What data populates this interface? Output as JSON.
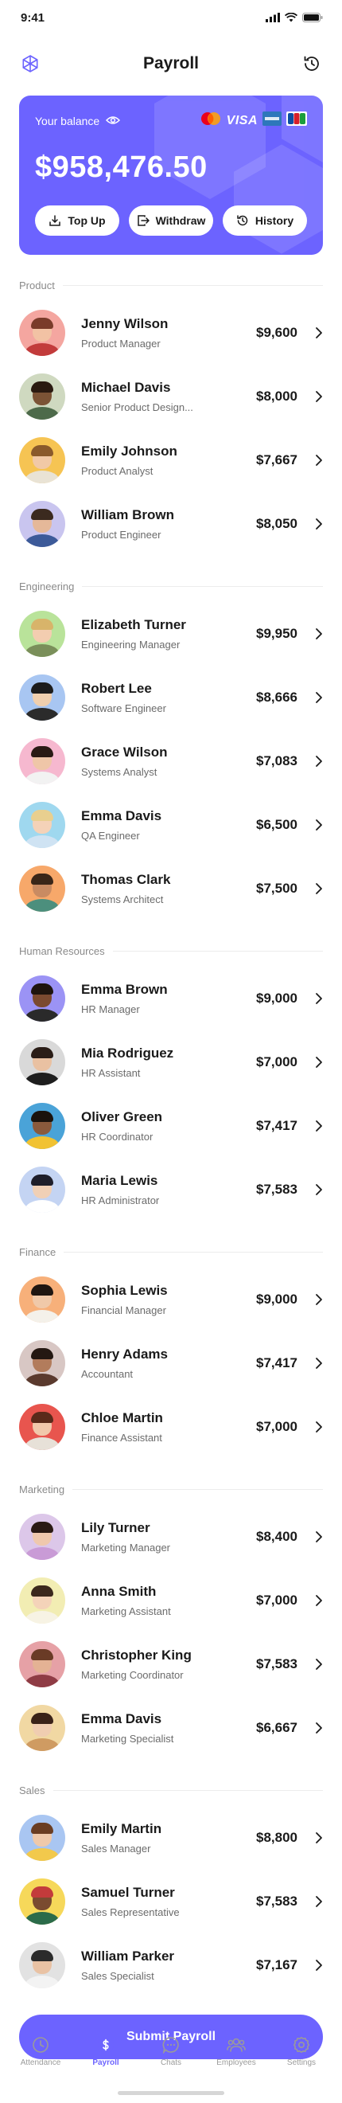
{
  "status": {
    "time": "9:41"
  },
  "header": {
    "title": "Payroll",
    "left_icon": "hexagon-logo-icon",
    "right_icon": "history-clock-icon"
  },
  "balance": {
    "label": "Your balance",
    "amount": "$958,476.50",
    "card_brands": [
      "Mastercard",
      "VISA",
      "AMEX",
      "JCB"
    ],
    "visa_text": "VISA",
    "actions": {
      "top_up": "Top Up",
      "withdraw": "Withdraw",
      "history": "History"
    },
    "color": "#6c63ff"
  },
  "sections": [
    {
      "label": "Product",
      "employees": [
        {
          "name": "Jenny Wilson",
          "role": "Product Manager",
          "amount": "$9,600",
          "bg": "#f4a6a0",
          "skin": "#f2c2a4",
          "hair": "#7a3b2a",
          "shirt": "#c23b3b"
        },
        {
          "name": "Michael Davis",
          "role": "Senior Product Design...",
          "amount": "$8,000",
          "bg": "#cfd9c0",
          "skin": "#7b5335",
          "hair": "#2a1a10",
          "shirt": "#4d6a4a"
        },
        {
          "name": "Emily Johnson",
          "role": "Product Analyst",
          "amount": "$7,667",
          "bg": "#f6c453",
          "skin": "#f1c9a6",
          "hair": "#8a5a2b",
          "shirt": "#e9e3d5"
        },
        {
          "name": "William Brown",
          "role": "Product Engineer",
          "amount": "$8,050",
          "bg": "#c9c5ef",
          "skin": "#e5b899",
          "hair": "#3b2a1f",
          "shirt": "#3c5a99"
        }
      ]
    },
    {
      "label": "Engineering",
      "employees": [
        {
          "name": "Elizabeth Turner",
          "role": "Engineering Manager",
          "amount": "$9,950",
          "bg": "#b9e39a",
          "skin": "#f3cdb0",
          "hair": "#d8b46a",
          "shirt": "#7a8f5a"
        },
        {
          "name": "Robert Lee",
          "role": "Software Engineer",
          "amount": "$8,666",
          "bg": "#a8c6f2",
          "skin": "#f0cfae",
          "hair": "#1c1c1c",
          "shirt": "#2b2b2b"
        },
        {
          "name": "Grace Wilson",
          "role": "Systems Analyst",
          "amount": "$7,083",
          "bg": "#f6b8cf",
          "skin": "#efc6a8",
          "hair": "#2a1a14",
          "shirt": "#f2f2f2"
        },
        {
          "name": "Emma Davis",
          "role": "QA Engineer",
          "amount": "$6,500",
          "bg": "#9fd8ef",
          "skin": "#f4d2b8",
          "hair": "#e8cf8f",
          "shirt": "#cfe3f3"
        },
        {
          "name": "Thomas Clark",
          "role": "Systems Architect",
          "amount": "$7,500",
          "bg": "#f7a86a",
          "skin": "#c98b62",
          "hair": "#3a2618",
          "shirt": "#4c8f7d"
        }
      ]
    },
    {
      "label": "Human Resources",
      "employees": [
        {
          "name": "Emma Brown",
          "role": "HR Manager",
          "amount": "$9,000",
          "bg": "#9b93f5",
          "skin": "#7b4a30",
          "hair": "#1e140e",
          "shirt": "#2a2a2a"
        },
        {
          "name": "Mia Rodriguez",
          "role": "HR Assistant",
          "amount": "$7,000",
          "bg": "#d9d9d9",
          "skin": "#e9c1a2",
          "hair": "#2a1d17",
          "shirt": "#1e1e1e"
        },
        {
          "name": "Oliver Green",
          "role": "HR Coordinator",
          "amount": "$7,417",
          "bg": "#4aa3d8",
          "skin": "#8a5a3c",
          "hair": "#1a120c",
          "shirt": "#f1c232"
        },
        {
          "name": "Maria Lewis",
          "role": "HR Administrator",
          "amount": "$7,583",
          "bg": "#c4d4f3",
          "skin": "#f0d0b6",
          "hair": "#1e1e2a",
          "shirt": "#ffffff"
        }
      ]
    },
    {
      "label": "Finance",
      "employees": [
        {
          "name": "Sophia Lewis",
          "role": "Financial Manager",
          "amount": "$9,000",
          "bg": "#f7b07a",
          "skin": "#f0c9a9",
          "hair": "#1f1611",
          "shirt": "#f4f1ea"
        },
        {
          "name": "Henry Adams",
          "role": "Accountant",
          "amount": "$7,417",
          "bg": "#d8c7c4",
          "skin": "#b27c5c",
          "hair": "#241812",
          "shirt": "#5a3a2e"
        },
        {
          "name": "Chloe Martin",
          "role": "Finance Assistant",
          "amount": "$7,000",
          "bg": "#e8554e",
          "skin": "#f1c8ab",
          "hair": "#5a2a1a",
          "shirt": "#e7e1d8"
        }
      ]
    },
    {
      "label": "Marketing",
      "employees": [
        {
          "name": "Lily Turner",
          "role": "Marketing Manager",
          "amount": "$8,400",
          "bg": "#dcc7e9",
          "skin": "#efc8ad",
          "hair": "#2a1a14",
          "shirt": "#c99bd6"
        },
        {
          "name": "Anna Smith",
          "role": "Marketing Assistant",
          "amount": "$7,000",
          "bg": "#f2edb3",
          "skin": "#f4d3b9",
          "hair": "#3b281d",
          "shirt": "#f7f3e4"
        },
        {
          "name": "Christopher King",
          "role": "Marketing Coordinator",
          "amount": "$7,583",
          "bg": "#e6a1a6",
          "skin": "#e4b294",
          "hair": "#6a3b26",
          "shirt": "#8f3c45"
        },
        {
          "name": "Emma Davis",
          "role": "Marketing Specialist",
          "amount": "$6,667",
          "bg": "#f1d8a3",
          "skin": "#f0cdb1",
          "hair": "#3a2218",
          "shirt": "#cf9b62"
        }
      ]
    },
    {
      "label": "Sales",
      "employees": [
        {
          "name": "Emily Martin",
          "role": "Sales Manager",
          "amount": "$8,800",
          "bg": "#a9c6f2",
          "skin": "#efc9ab",
          "hair": "#6a3d22",
          "shirt": "#f2c94c"
        },
        {
          "name": "Samuel Turner",
          "role": "Sales Representative",
          "amount": "$7,583",
          "bg": "#f6d85a",
          "skin": "#7a4b30",
          "hair": "#c33b3b",
          "shirt": "#2b6b4a"
        },
        {
          "name": "William Parker",
          "role": "Sales Specialist",
          "amount": "$7,167",
          "bg": "#e2e2e2",
          "skin": "#e9c2a4",
          "hair": "#2b2b2b",
          "shirt": "#f3f3f3"
        }
      ]
    }
  ],
  "submit": {
    "label": "Submit Payroll"
  },
  "tabs": [
    {
      "label": "Attendance",
      "icon": "clock-icon",
      "active": false
    },
    {
      "label": "Payroll",
      "icon": "dollar-icon",
      "active": true
    },
    {
      "label": "Chats",
      "icon": "chat-icon",
      "active": false
    },
    {
      "label": "Employees",
      "icon": "people-icon",
      "active": false
    },
    {
      "label": "Settings",
      "icon": "gear-icon",
      "active": false
    }
  ]
}
